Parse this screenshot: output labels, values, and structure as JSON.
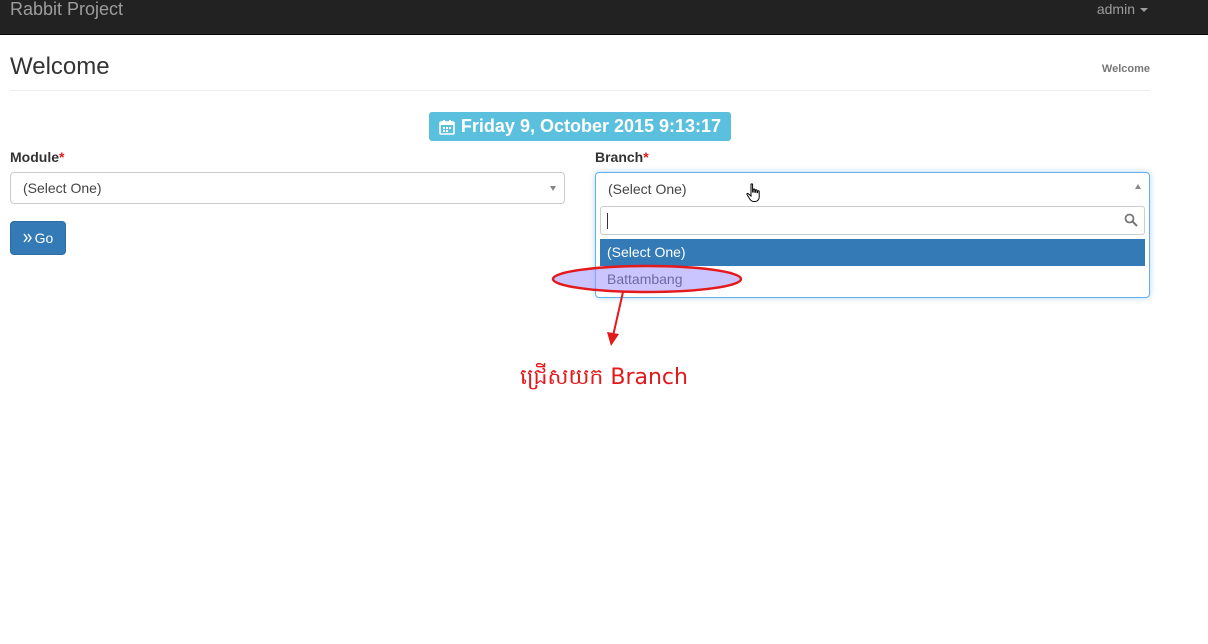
{
  "navbar": {
    "brand": "Rabbit Project",
    "user": "admin"
  },
  "header": {
    "title": "Welcome",
    "breadcrumb": "Welcome"
  },
  "date_badge": {
    "text": "Friday 9, October 2015 9:13:17",
    "icon": "calendar-icon"
  },
  "form": {
    "module_label": "Module",
    "branch_label": "Branch",
    "required_mark": "*",
    "module_value": "(Select One)",
    "branch_value": "(Select One)",
    "go_label": "Go",
    "go_icon": "double-chevron-right-icon"
  },
  "branch_dropdown": {
    "search_value": "",
    "options": [
      "(Select One)",
      "Battambang"
    ],
    "highlighted_option": "(Select One)"
  },
  "annotation": {
    "text": "ជ្រើសយក Branch",
    "color": "#e3191c"
  },
  "colors": {
    "primary": "#337ab7",
    "info": "#5bc0de",
    "navbar": "#222222"
  }
}
